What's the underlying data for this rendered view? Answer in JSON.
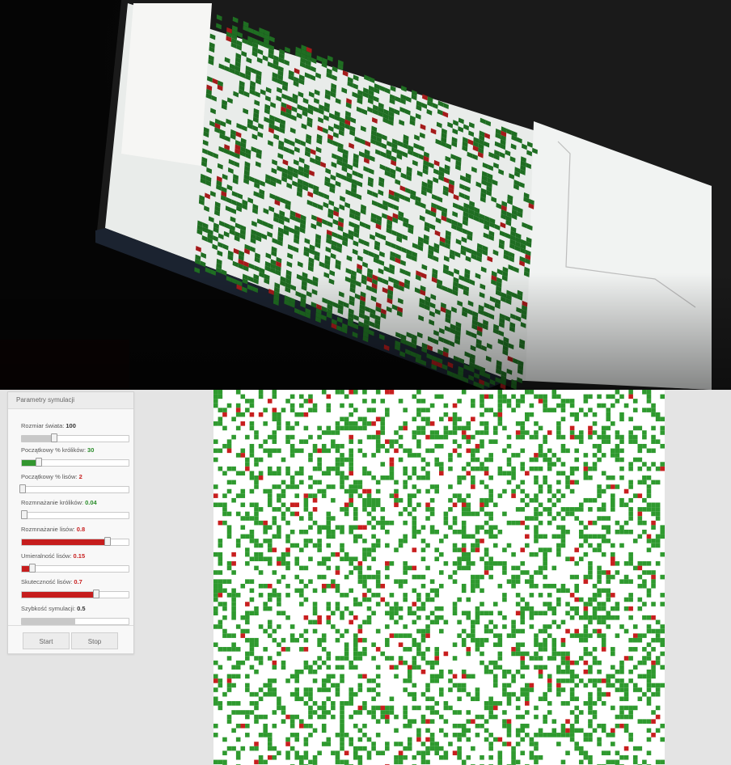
{
  "panel": {
    "title": "Parametry symulacji",
    "params": [
      {
        "label": "Rozmiar świata:",
        "value": "100",
        "level": 0.3,
        "color": "gray"
      },
      {
        "label": "Początkowy % królików:",
        "value": "30",
        "level": 0.16,
        "color": "green"
      },
      {
        "label": "Początkowy % lisów:",
        "value": "2",
        "level": 0.01,
        "color": "red"
      },
      {
        "label": "Rozmnażanie królików:",
        "value": "0.04",
        "level": 0.02,
        "color": "green"
      },
      {
        "label": "Rozmnażanie lisów:",
        "value": "0.8",
        "level": 0.8,
        "color": "red"
      },
      {
        "label": "Umieralność lisów:",
        "value": "0.15",
        "level": 0.1,
        "color": "red"
      },
      {
        "label": "Skuteczność lisów:",
        "value": "0.7",
        "level": 0.7,
        "color": "red"
      },
      {
        "label": "Szybkość symulacji:",
        "value": "0.5",
        "level": 0.5,
        "color": "gray"
      }
    ],
    "start_label": "Start",
    "stop_label": "Stop"
  },
  "simulation": {
    "cell_colors": {
      "empty": "#ffffff",
      "rabbit": "#2f9a2f",
      "fox": "#c81e1e"
    }
  }
}
